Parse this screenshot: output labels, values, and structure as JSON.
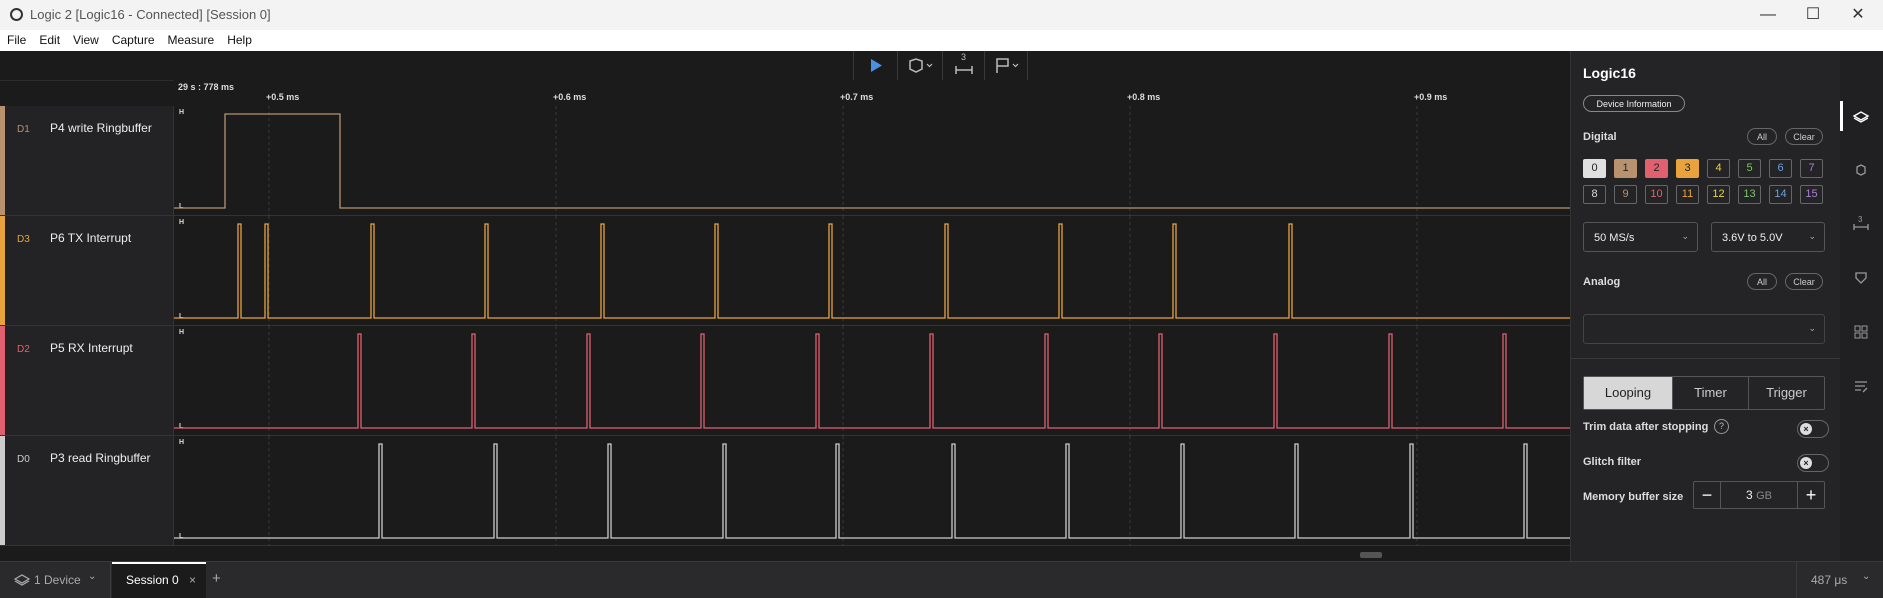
{
  "window": {
    "title": "Logic 2 [Logic16 - Connected] [Session 0]",
    "minimize_glyph": "—",
    "maximize_glyph": "☐",
    "close_glyph": "✕"
  },
  "menu": [
    "File",
    "Edit",
    "View",
    "Capture",
    "Measure",
    "Help"
  ],
  "toolbar": {
    "marker_count": "3",
    "play_color": "#4a90e2"
  },
  "timeline": {
    "cursor_time": "29 s : 778 ms",
    "ticks": [
      "+0.5 ms",
      "+0.6 ms",
      "+0.7 ms",
      "+0.8 ms",
      "+0.9 ms"
    ]
  },
  "channels": [
    {
      "id": "D1",
      "name": "P4 write Ringbuffer",
      "color": "#b8926f",
      "high": "H",
      "low": "L"
    },
    {
      "id": "D3",
      "name": "P6 TX Interrupt",
      "color": "#e8a33d",
      "high": "H",
      "low": "L"
    },
    {
      "id": "D2",
      "name": "P5 RX Interrupt",
      "color": "#e0606f",
      "high": "H",
      "low": "L"
    },
    {
      "id": "D0",
      "name": "P3 read Ringbuffer",
      "color": "#cccccc",
      "high": "H",
      "low": "L"
    }
  ],
  "panel": {
    "device_name": "Logic16",
    "device_info_label": "Device Information",
    "digital_label": "Digital",
    "all_label": "All",
    "clear_label": "Clear",
    "digital_channels": [
      "0",
      "1",
      "2",
      "3",
      "4",
      "5",
      "6",
      "7",
      "8",
      "9",
      "10",
      "11",
      "12",
      "13",
      "14",
      "15"
    ],
    "sample_rate": "50 MS/s",
    "voltage": "3.6V to 5.0V",
    "analog_label": "Analog",
    "analog_value": "",
    "modes": [
      "Looping",
      "Timer",
      "Trigger"
    ],
    "active_mode": "Looping",
    "trim_label": "Trim data after stopping",
    "glitch_label": "Glitch filter",
    "memory_label": "Memory buffer size",
    "memory_value": "3",
    "memory_unit": "GB",
    "minus": "−",
    "plus": "+"
  },
  "bottom": {
    "device_tab": "1 Device",
    "session_tab": "Session 0",
    "close_glyph": "×",
    "add_glyph": "+",
    "duration": "487 μs"
  }
}
